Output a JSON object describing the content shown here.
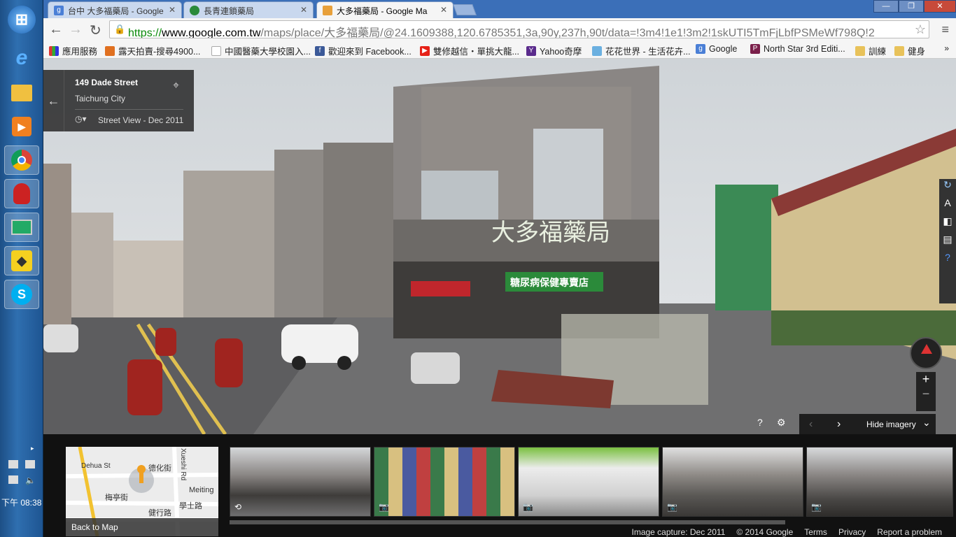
{
  "tabs": [
    {
      "label": "台中 大多福藥局 - Google",
      "icon": "google-g-icon",
      "color": "#4a7fd6"
    },
    {
      "label": "長青連鎖藥局",
      "icon": "site-icon",
      "color": "#2a8a3a"
    },
    {
      "label": "大多福藥局 - Google Ma",
      "icon": "maps-icon",
      "color": "#e8a03a"
    }
  ],
  "address": {
    "protocol": "https://",
    "host": "www.google.com.tw",
    "path": "/maps/place/大多福藥局/@24.1609388,120.6785351,3a,90y,237h,90t/data=!3m4!1e1!3m2!1skUTI5TmFjLbfPSMeWf798Q!2"
  },
  "bookmarks": [
    {
      "label": "應用服務",
      "icon": "apps-icon",
      "color": "#d33"
    },
    {
      "label": "露天拍賣-搜尋4900...",
      "icon": "ruten-icon",
      "color": "#e07020"
    },
    {
      "label": "中國醫藥大學校園入...",
      "icon": "page-icon",
      "color": "#bbb"
    },
    {
      "label": "歡迎來到 Facebook...",
      "icon": "facebook-icon",
      "color": "#3b5998"
    },
    {
      "label": "雙修越信・單挑大龍...",
      "icon": "youtube-icon",
      "color": "#e62117"
    },
    {
      "label": "Yahoo奇摩",
      "icon": "yahoo-icon",
      "color": "#5a2b8c"
    },
    {
      "label": "花花世界 - 生活花卉...",
      "icon": "flower-icon",
      "color": "#6bb0e0"
    },
    {
      "label": "Google",
      "icon": "google-icon",
      "color": "#4a7fd6"
    },
    {
      "label": "North Star 3rd Editi...",
      "icon": "pearson-icon",
      "color": "#7a1f4a"
    },
    {
      "label": "訓練",
      "icon": "folder-icon",
      "color": "#e8c25a"
    },
    {
      "label": "健身",
      "icon": "folder-icon",
      "color": "#e8c25a"
    }
  ],
  "info": {
    "street": "149 Dade Street",
    "city": "Taichung City",
    "date": "Street View - Dec 2011"
  },
  "shop": {
    "sign": "大多福藥局",
    "banner": "糖尿病保健專賣店"
  },
  "controls": {
    "hide_imagery": "Hide imagery",
    "zoom_in": "+",
    "zoom_out": "−"
  },
  "minimap": {
    "street1": "Dehua St",
    "street2": "德化街",
    "street3": "梅亭街",
    "street4": "健行路",
    "street5": "Meiting",
    "street6": "學士路",
    "street7": "Xueshi Rd",
    "back": "Back to Map"
  },
  "footer": {
    "capture": "Image capture: Dec 2011",
    "copyright": "© 2014 Google",
    "terms": "Terms",
    "privacy": "Privacy",
    "report": "Report a problem"
  },
  "tray": {
    "time": "下午 08:38"
  },
  "colors": {
    "taskbar": "#2a64a6",
    "tab_strip": "#3b6fb8",
    "https_green": "#0a8a0a",
    "banner_green": "#2b8a3a"
  }
}
